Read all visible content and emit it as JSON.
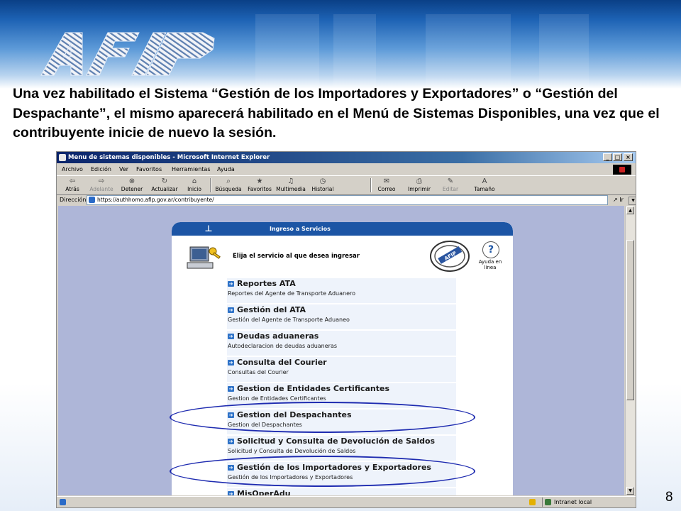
{
  "slide": {
    "logo_text": "AFIP",
    "instruction": "Una vez habilitado el Sistema “Gestión de los Importadores y Exportadores” o “Gestión del Despachante”, el mismo aparecerá habilitado en el Menú de Sistemas Disponibles, una vez que el contribuyente inicie de nuevo la sesión.",
    "page_number": "8"
  },
  "browser": {
    "window_title": "Menu de sistemas disponibles - Microsoft Internet Explorer",
    "window_buttons": [
      "_",
      "□",
      "×"
    ],
    "menu": [
      "Archivo",
      "Edición",
      "Ver",
      "Favoritos",
      "Herramientas",
      "Ayuda"
    ],
    "toolbar": [
      {
        "label": "Atrás",
        "icon": "back-icon",
        "enabled": true
      },
      {
        "label": "Adelante",
        "icon": "forward-icon",
        "enabled": false
      },
      {
        "label": "Detener",
        "icon": "stop-icon",
        "enabled": true
      },
      {
        "label": "Actualizar",
        "icon": "refresh-icon",
        "enabled": true
      },
      {
        "label": "Inicio",
        "icon": "home-icon",
        "enabled": true
      },
      {
        "label": "Búsqueda",
        "icon": "search-icon",
        "enabled": true
      },
      {
        "label": "Favoritos",
        "icon": "favorites-icon",
        "enabled": true
      },
      {
        "label": "Multimedia",
        "icon": "media-icon",
        "enabled": true
      },
      {
        "label": "Historial",
        "icon": "history-icon",
        "enabled": true
      },
      {
        "label": "Correo",
        "icon": "mail-icon",
        "enabled": true
      },
      {
        "label": "Imprimir",
        "icon": "print-icon",
        "enabled": true
      },
      {
        "label": "Editar",
        "icon": "edit-icon",
        "enabled": false
      },
      {
        "label": "Tamaño",
        "icon": "font-size-icon",
        "enabled": true
      }
    ],
    "address_label": "Dirección",
    "address_url": "https://authhomo.afip.gov.ar/contribuyente/",
    "go_label": "Ir",
    "status_zone": "Intranet local"
  },
  "page": {
    "header_title": "Ingreso a Servicios",
    "prompt": "Elija el servicio al que desea ingresar",
    "help_label": "Ayuda en línea",
    "seal_text": "AFIP",
    "services": [
      {
        "title": "Reportes ATA",
        "subtitle": "Reportes del Agente de Transporte Aduanero"
      },
      {
        "title": "Gestión del ATA",
        "subtitle": "Gestión del Agente de Transporte Aduaneo"
      },
      {
        "title": "Deudas aduaneras",
        "subtitle": "Autodeclaracion de deudas aduaneras"
      },
      {
        "title": "Consulta del Courier",
        "subtitle": "Consultas del Courier"
      },
      {
        "title": "Gestion de Entidades Certificantes",
        "subtitle": "Gestion de Entidades Certificantes"
      },
      {
        "title": "Gestion del Despachantes",
        "subtitle": "Gestion del Despachantes"
      },
      {
        "title": "Solicitud y Consulta de Devolución de Saldos",
        "subtitle": "Solicitud y Consulta de Devolución de Saldos"
      },
      {
        "title": "Gestión de los Importadores y Exportadores",
        "subtitle": "Gestión de los Importadores y Exportadores"
      },
      {
        "title": "MisOperAdu",
        "subtitle": ""
      }
    ]
  },
  "colors": {
    "highlight_ellipse": "#1e2bb0",
    "panel_header": "#1c55a5",
    "page_background": "#aeb6d8"
  }
}
